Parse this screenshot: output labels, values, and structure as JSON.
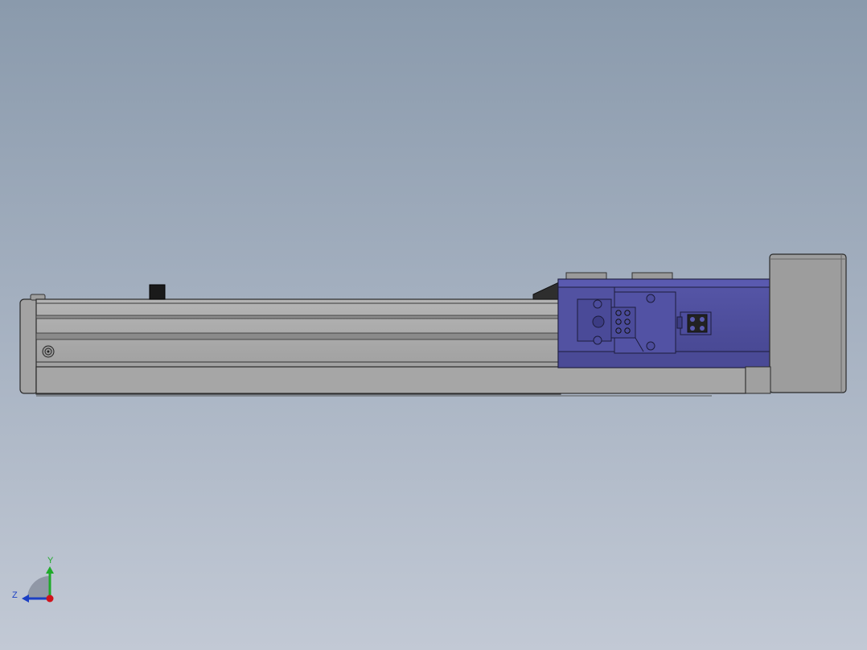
{
  "viewport": {
    "background_top": "#8a9aac",
    "background_bottom": "#c2c9d5"
  },
  "model": {
    "name": "linear-actuator-with-servo-motor",
    "rail_color": "#a7a7a7",
    "motor_color": "#4f50a0",
    "endcap_color": "#9d9d9d"
  },
  "triad": {
    "y_label": "Y",
    "z_label": "Z",
    "y_color": "#1faa2a",
    "z_color": "#1b3fc4",
    "origin_color": "#d0121b"
  }
}
